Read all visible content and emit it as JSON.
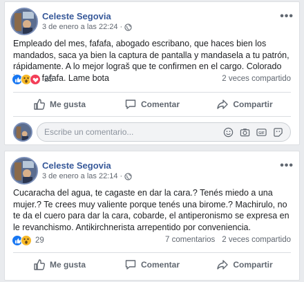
{
  "posts": [
    {
      "author": "Celeste Segovia",
      "date": "3 de enero a las 22:24",
      "separator": "·",
      "text": "Empleado del mes, fafafa, abogado escribano, que haces bien los mandados, saca ya bien la captura de pantalla y mandasela a tu patrón, rápidamente. A lo mejor lograš que te confirmen en el cargo. Colorado bruto y fafafa. Lame bota",
      "reaction_icons": [
        "like",
        "wow",
        "love"
      ],
      "reaction_count": "25",
      "comments_count": "",
      "shares": "2 veces compartido",
      "actions": {
        "like": "Me gusta",
        "comment": "Comentar",
        "share": "Compartir"
      },
      "comment_placeholder": "Escribe un comentario..."
    },
    {
      "author": "Celeste Segovia",
      "date": "3 de enero a las 22:14",
      "separator": "·",
      "text": "Cucaracha del agua, te cagaste en dar la cara.? Tenés miedo a una mujer.? Te crees muy valiente porque tenés una birome.? Machirulo, no te da el cuero para dar la cara, cobarde, el antiperonismo se expresa en le revanchismo. Antikirchnerista arrepentido por conveniencia.",
      "reaction_icons": [
        "like",
        "wow"
      ],
      "reaction_count": "29",
      "comments_count": "7 comentarios",
      "shares": "2 veces compartido",
      "actions": {
        "like": "Me gusta",
        "comment": "Comentar",
        "share": "Compartir"
      }
    }
  ],
  "colors": {
    "link": "#365899",
    "like": "#1877f2",
    "wow": "#f7b928",
    "love": "#f33e58",
    "muted": "#606770",
    "background": "#e9ebee"
  },
  "icons": [
    "globe-icon",
    "more-options-icon",
    "thumbs-up-icon",
    "comment-icon",
    "share-icon",
    "emoji-icon",
    "camera-icon",
    "gif-icon",
    "sticker-icon"
  ]
}
